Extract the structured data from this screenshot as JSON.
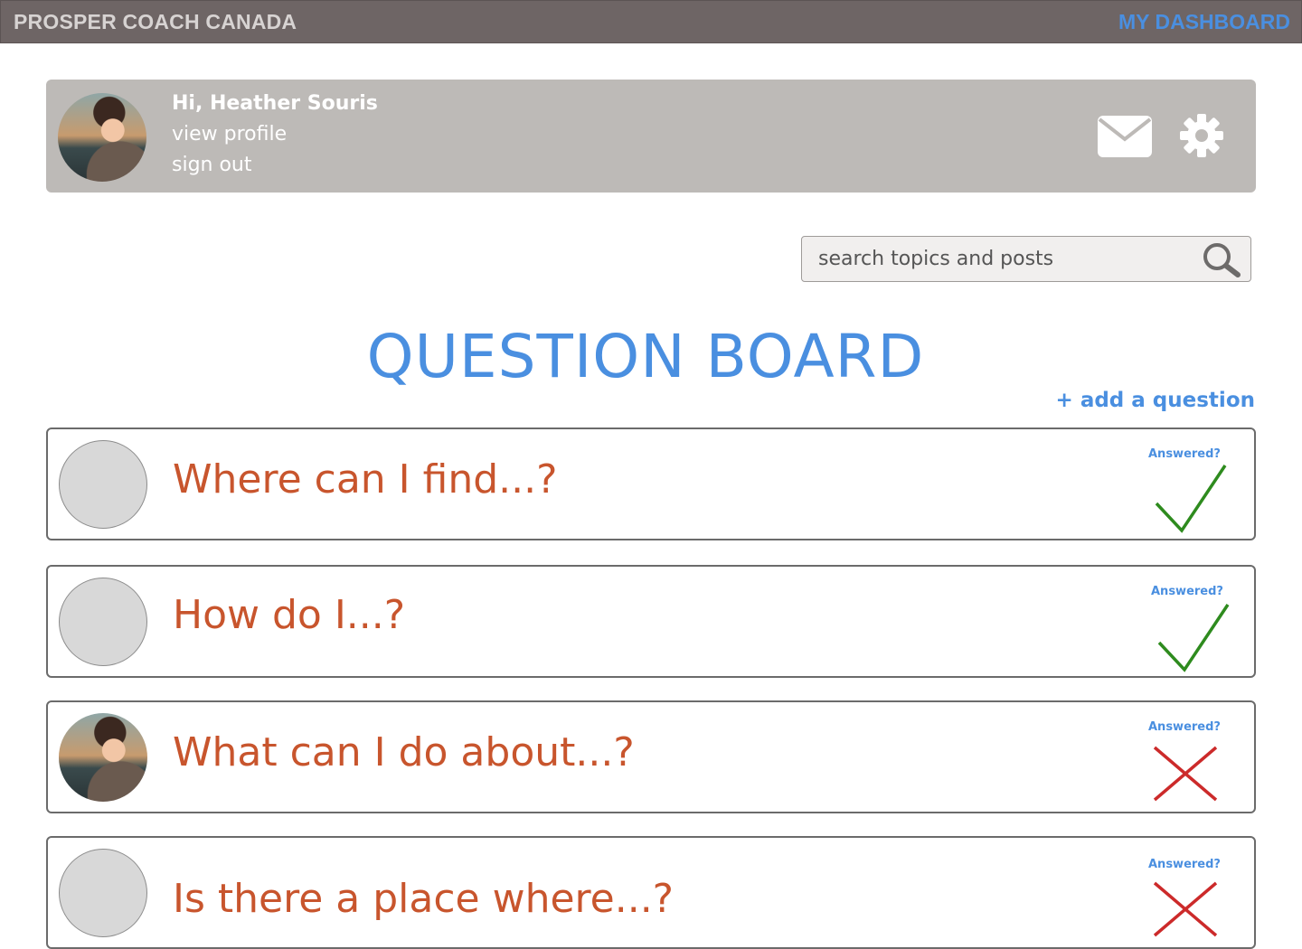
{
  "topbar": {
    "brand": "PROSPER COACH CANADA",
    "dashboard_link": "MY DASHBOARD"
  },
  "profile": {
    "greeting": "Hi, Heather Souris",
    "view_profile": "view profile",
    "sign_out": "sign out",
    "icons": [
      "mail-icon",
      "gear-icon"
    ]
  },
  "search": {
    "placeholder": "search topics and posts",
    "icon": "search-icon"
  },
  "board": {
    "title": "QUESTION BOARD",
    "add_question": "+ add a question"
  },
  "questions": [
    {
      "text": "Where can I find...?",
      "answered_label": "Answered?",
      "answered": true,
      "avatar": "empty"
    },
    {
      "text": "How do I...?",
      "answered_label": "Answered?",
      "answered": true,
      "avatar": "empty"
    },
    {
      "text": "What can I do about...?",
      "answered_label": "Answered?",
      "answered": false,
      "avatar": "photo"
    },
    {
      "text": "Is there a place where...?",
      "answered_label": "Answered?",
      "answered": false,
      "avatar": "empty"
    }
  ],
  "colors": {
    "accent_blue": "#4a8fe0",
    "question_orange": "#c8552d",
    "check_green": "#2e8b1e",
    "cross_red": "#cc2a2a",
    "topbar": "#6e6565",
    "profile_card": "#bdbab7"
  }
}
